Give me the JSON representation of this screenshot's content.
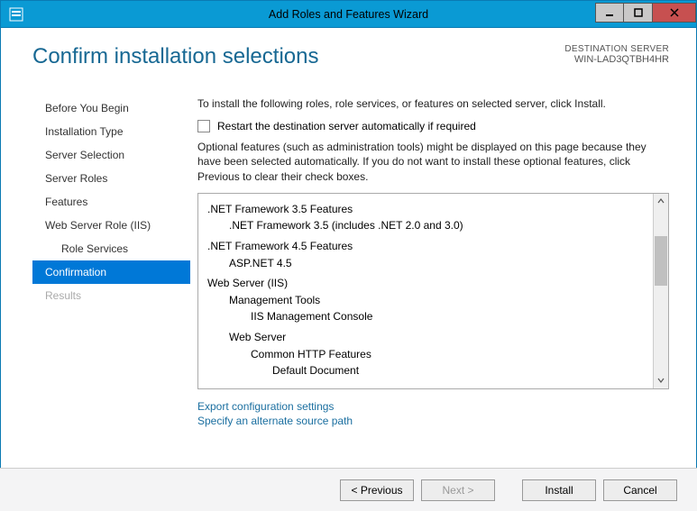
{
  "window": {
    "title": "Add Roles and Features Wizard"
  },
  "destination": {
    "label": "DESTINATION SERVER",
    "value": "WIN-LAD3QTBH4HR"
  },
  "page_title": "Confirm installation selections",
  "nav": {
    "items": [
      {
        "label": "Before You Begin"
      },
      {
        "label": "Installation Type"
      },
      {
        "label": "Server Selection"
      },
      {
        "label": "Server Roles"
      },
      {
        "label": "Features"
      },
      {
        "label": "Web Server Role (IIS)"
      },
      {
        "label": "Role Services"
      },
      {
        "label": "Confirmation"
      },
      {
        "label": "Results"
      }
    ]
  },
  "instruction": "To install the following roles, role services, or features on selected server, click Install.",
  "restart_checkbox_label": "Restart the destination server automatically if required",
  "optional_text": "Optional features (such as administration tools) might be displayed on this page because they have been selected automatically. If you do not want to install these optional features, click Previous to clear their check boxes.",
  "feature_tree": [
    {
      "level": 0,
      "text": ".NET Framework 3.5 Features"
    },
    {
      "level": 1,
      "text": ".NET Framework 3.5 (includes .NET 2.0 and 3.0)"
    },
    {
      "level": 0,
      "text": ".NET Framework 4.5 Features"
    },
    {
      "level": 1,
      "text": "ASP.NET 4.5"
    },
    {
      "level": 0,
      "text": "Web Server (IIS)"
    },
    {
      "level": 1,
      "text": "Management Tools"
    },
    {
      "level": 2,
      "text": "IIS Management Console"
    },
    {
      "level": 1,
      "text": "Web Server"
    },
    {
      "level": 2,
      "text": "Common HTTP Features"
    },
    {
      "level": 3,
      "text": "Default Document"
    }
  ],
  "links": {
    "export": "Export configuration settings",
    "alt_source": "Specify an alternate source path"
  },
  "buttons": {
    "previous": "< Previous",
    "next": "Next >",
    "install": "Install",
    "cancel": "Cancel"
  }
}
